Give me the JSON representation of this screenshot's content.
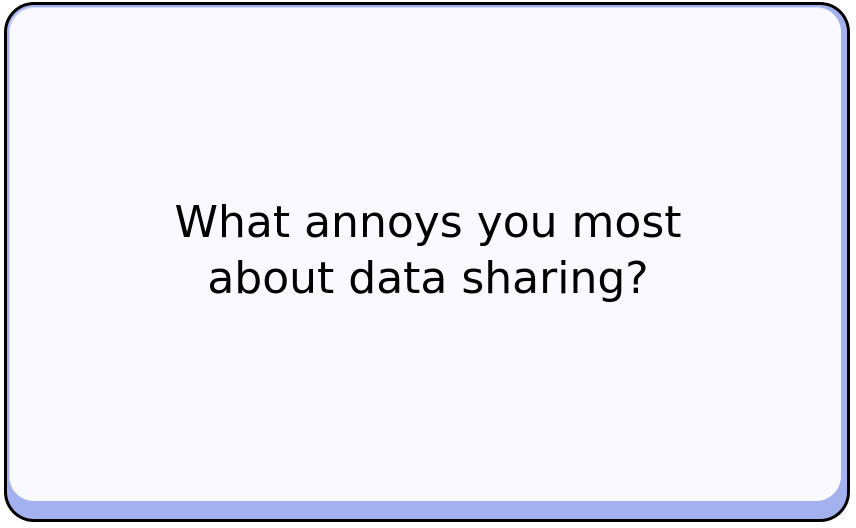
{
  "dialog": {
    "question_line_1": "What annoys you most",
    "question_line_2": "about data sharing?"
  },
  "colors": {
    "outline": "#000000",
    "bevel": "#a3b1ee",
    "face": "#f9f9ff",
    "text": "#000000"
  }
}
